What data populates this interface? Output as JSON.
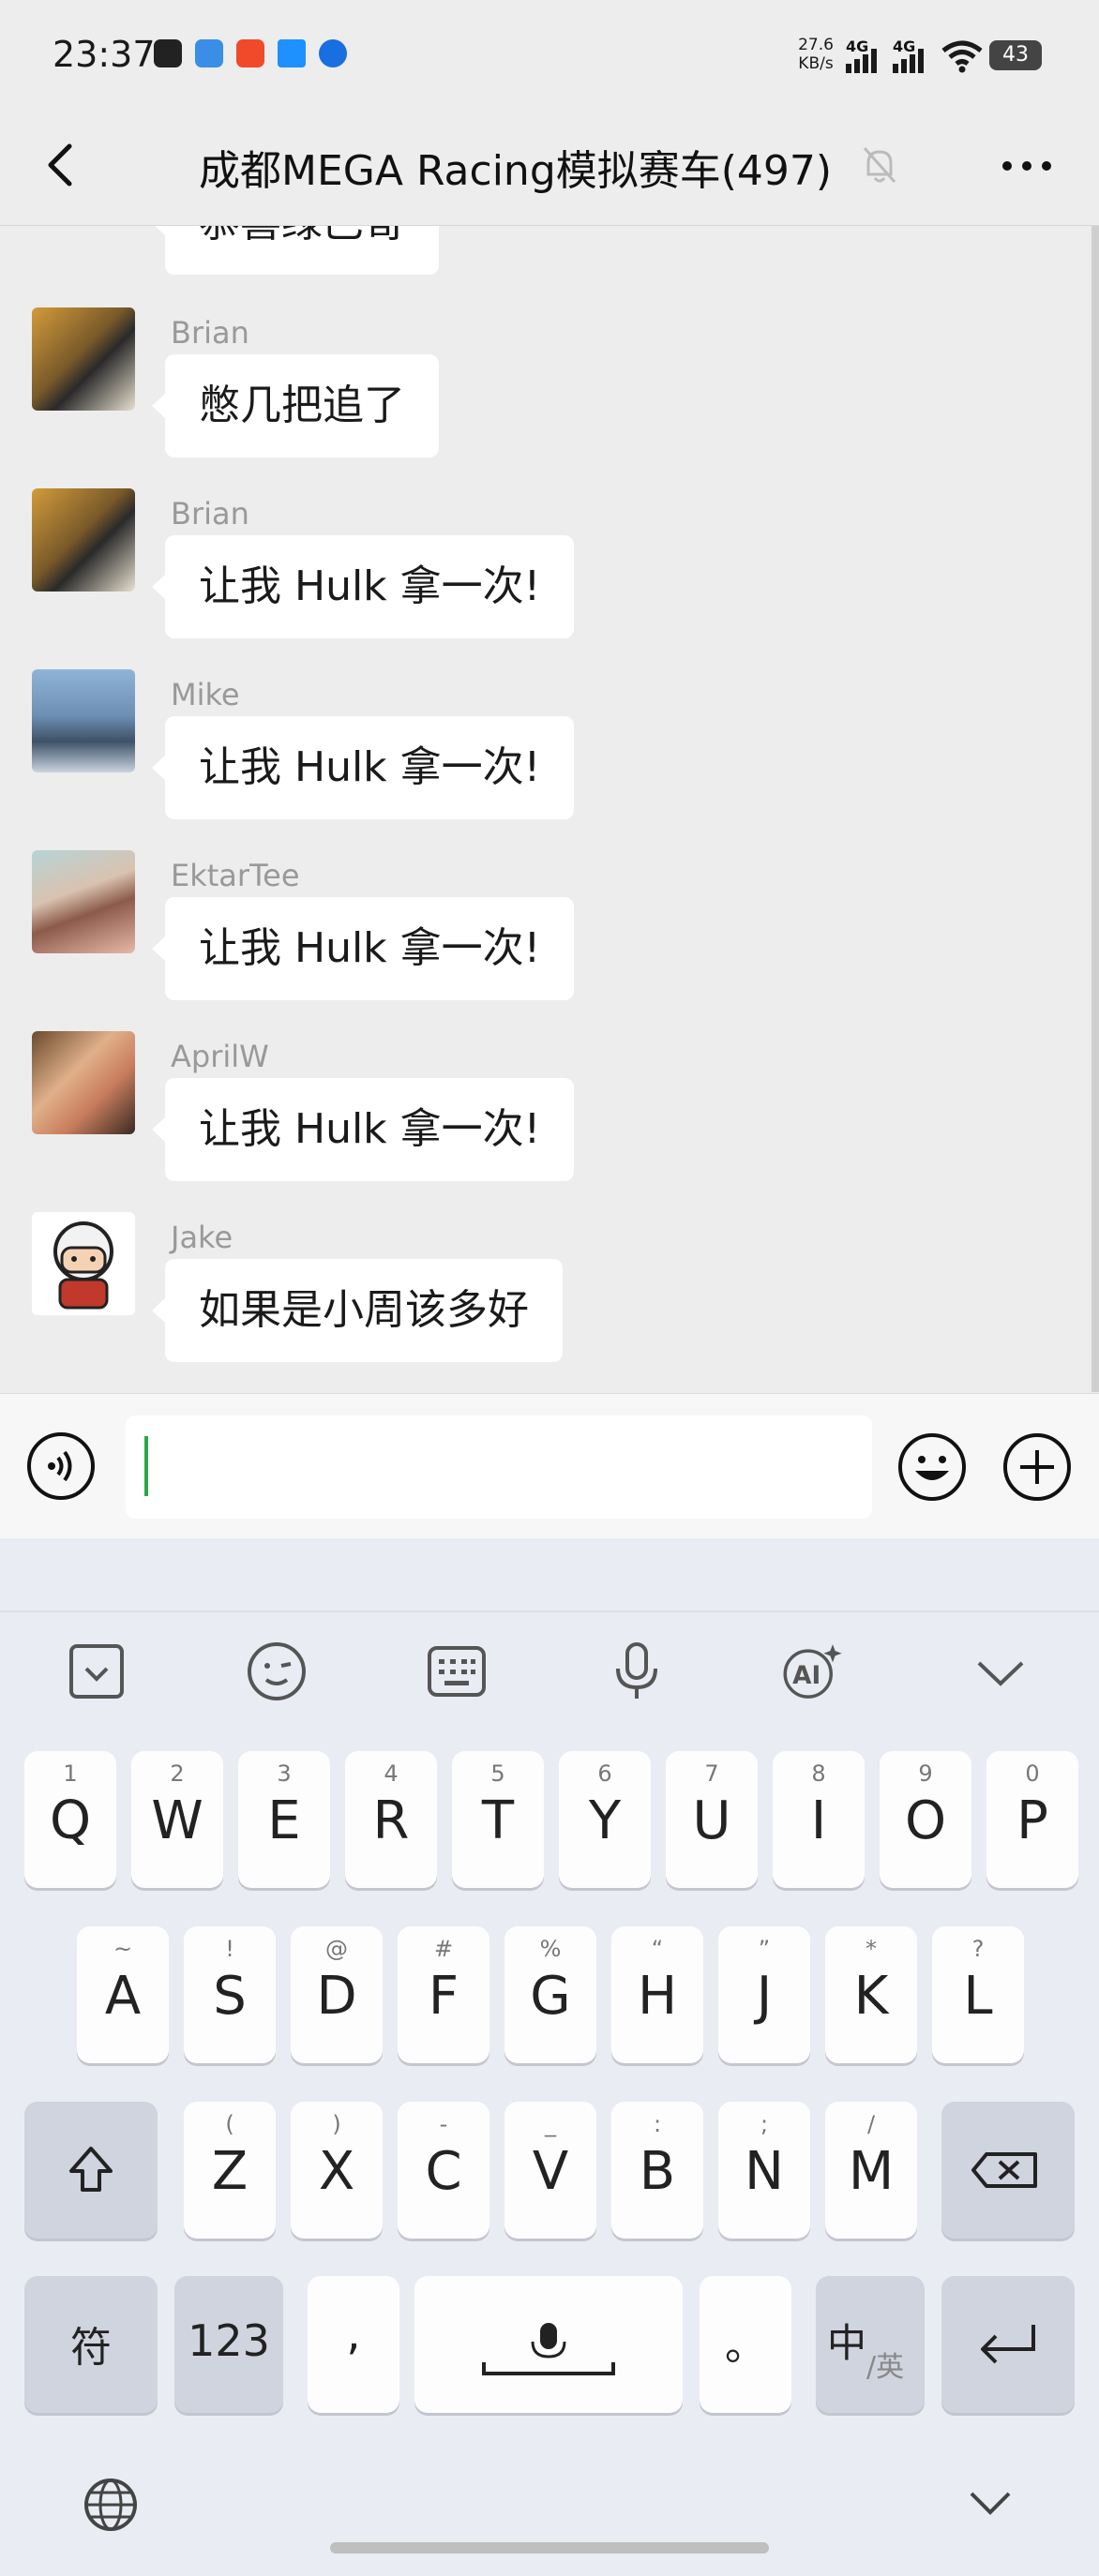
{
  "status_bar": {
    "time": "23:37",
    "net_speed_value": "27.6",
    "net_speed_unit": "KB/s",
    "network_1": "4G",
    "network_2": "4G",
    "battery": "43"
  },
  "header": {
    "title": "成都MEGA Racing模拟赛车(497)",
    "icons": [
      "back-icon",
      "mute-bell-icon",
      "more-icon"
    ]
  },
  "chat": {
    "partial_message": "恭喜绿巴哥",
    "messages": [
      {
        "sender": "Brian",
        "text": "憋几把追了"
      },
      {
        "sender": "Brian",
        "text": "让我 Hulk 拿一次!"
      },
      {
        "sender": "Mike",
        "text": "让我 Hulk 拿一次!"
      },
      {
        "sender": "EktarTee",
        "text": "让我 Hulk 拿一次!"
      },
      {
        "sender": "AprilW",
        "text": "让我 Hulk 拿一次!"
      },
      {
        "sender": "Jake",
        "text": "如果是小周该多好"
      }
    ]
  },
  "input_bar": {
    "value": "",
    "icons": [
      "voice-icon",
      "emoji-icon",
      "plus-icon"
    ]
  },
  "keyboard": {
    "toolbar": [
      "clipboard-icon",
      "emoji-face-icon",
      "keyboard-icon",
      "microphone-icon",
      "ai-icon",
      "collapse-icon"
    ],
    "row1": [
      {
        "key": "Q",
        "hint": "1"
      },
      {
        "key": "W",
        "hint": "2"
      },
      {
        "key": "E",
        "hint": "3"
      },
      {
        "key": "R",
        "hint": "4"
      },
      {
        "key": "T",
        "hint": "5"
      },
      {
        "key": "Y",
        "hint": "6"
      },
      {
        "key": "U",
        "hint": "7"
      },
      {
        "key": "I",
        "hint": "8"
      },
      {
        "key": "O",
        "hint": "9"
      },
      {
        "key": "P",
        "hint": "0"
      }
    ],
    "row2": [
      {
        "key": "A",
        "hint": "~"
      },
      {
        "key": "S",
        "hint": "!"
      },
      {
        "key": "D",
        "hint": "@"
      },
      {
        "key": "F",
        "hint": "#"
      },
      {
        "key": "G",
        "hint": "%"
      },
      {
        "key": "H",
        "hint": "“"
      },
      {
        "key": "J",
        "hint": "”"
      },
      {
        "key": "K",
        "hint": "*"
      },
      {
        "key": "L",
        "hint": "?"
      }
    ],
    "row3": [
      {
        "key": "Z",
        "hint": "("
      },
      {
        "key": "X",
        "hint": ")"
      },
      {
        "key": "C",
        "hint": "-"
      },
      {
        "key": "V",
        "hint": "_"
      },
      {
        "key": "B",
        "hint": ":"
      },
      {
        "key": "N",
        "hint": ";"
      },
      {
        "key": "M",
        "hint": "/"
      }
    ],
    "symbols_key": "符",
    "numbers_key": "123",
    "comma_key": ",",
    "period_key": "。",
    "lang_key_main": "中",
    "lang_key_sub": "/英"
  }
}
